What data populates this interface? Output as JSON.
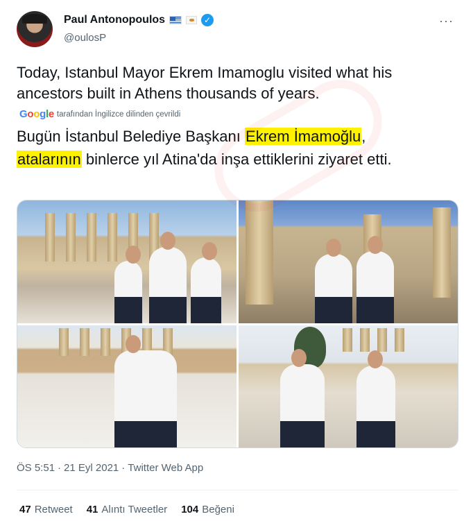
{
  "author": {
    "display_name": "Paul Antonopoulos",
    "handle": "@oulosP",
    "verified_icon": "verified-badge-icon",
    "flag_icons": [
      "greece-flag-icon",
      "cyprus-flag-icon"
    ],
    "menu_glyph": "···"
  },
  "tweet": {
    "text": "Today, Istanbul Mayor Ekrem Imamoglu visited what his ancestors built in Athens thousands of years.",
    "translation_note": "tarafından İngilizce dilinden çevrildi",
    "translation_brand": "Google",
    "translated": {
      "part1": "Bugün İstanbul Belediye Başkanı ",
      "highlight1": "Ekrem İmamoğlu",
      "part2": ",",
      "highlight2": "atalarının",
      "part3": " binlerce yıl Atina'da inşa ettiklerini ziyaret etti."
    }
  },
  "media": [
    {
      "name": "photo-acropolis-walk"
    },
    {
      "name": "photo-propylaea-steps"
    },
    {
      "name": "photo-parthenon-portrait"
    },
    {
      "name": "photo-acropolis-seated"
    }
  ],
  "meta": {
    "time": "ÖS 5:51",
    "separator": "·",
    "date": "21 Eyl 2021",
    "source": "Twitter Web App"
  },
  "stats": {
    "retweets_count": "47",
    "retweets_label": "Retweet",
    "quotes_count": "41",
    "quotes_label": "Alıntı Tweetler",
    "likes_count": "104",
    "likes_label": "Beğeni"
  },
  "colors": {
    "text_primary": "#0f1419",
    "text_secondary": "#536471",
    "verified_blue": "#1d9bf0",
    "highlight_yellow": "#fff200"
  }
}
